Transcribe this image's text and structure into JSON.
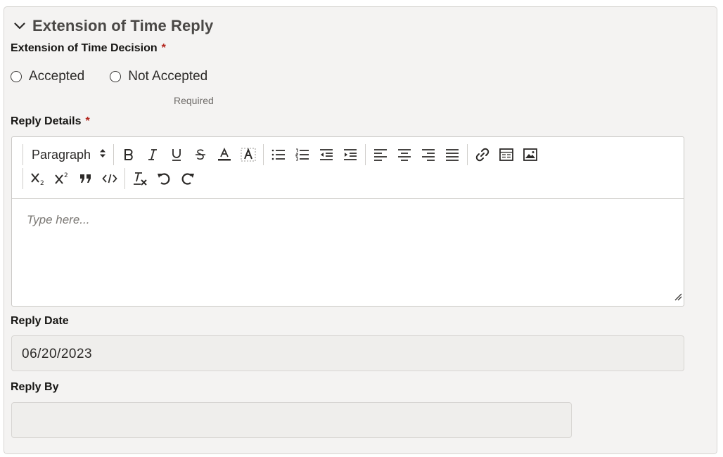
{
  "section": {
    "title": "Extension of Time Reply",
    "collapse_icon": "chevron-down-icon"
  },
  "decision": {
    "label": "Extension of Time Decision",
    "required_marker": "*",
    "options": [
      "Accepted",
      "Not Accepted"
    ],
    "selected": null,
    "helper": "Required"
  },
  "reply_details": {
    "label": "Reply Details",
    "required_marker": "*",
    "toolbar": {
      "format_select": "Paragraph"
    },
    "placeholder": "Type here..."
  },
  "reply_date": {
    "label": "Reply Date",
    "value": "06/20/2023"
  },
  "reply_by": {
    "label": "Reply By",
    "value": ""
  },
  "colors": {
    "panel_bg": "#f4f3f2",
    "required": "#b3261e",
    "field_bg": "#efeeec"
  }
}
